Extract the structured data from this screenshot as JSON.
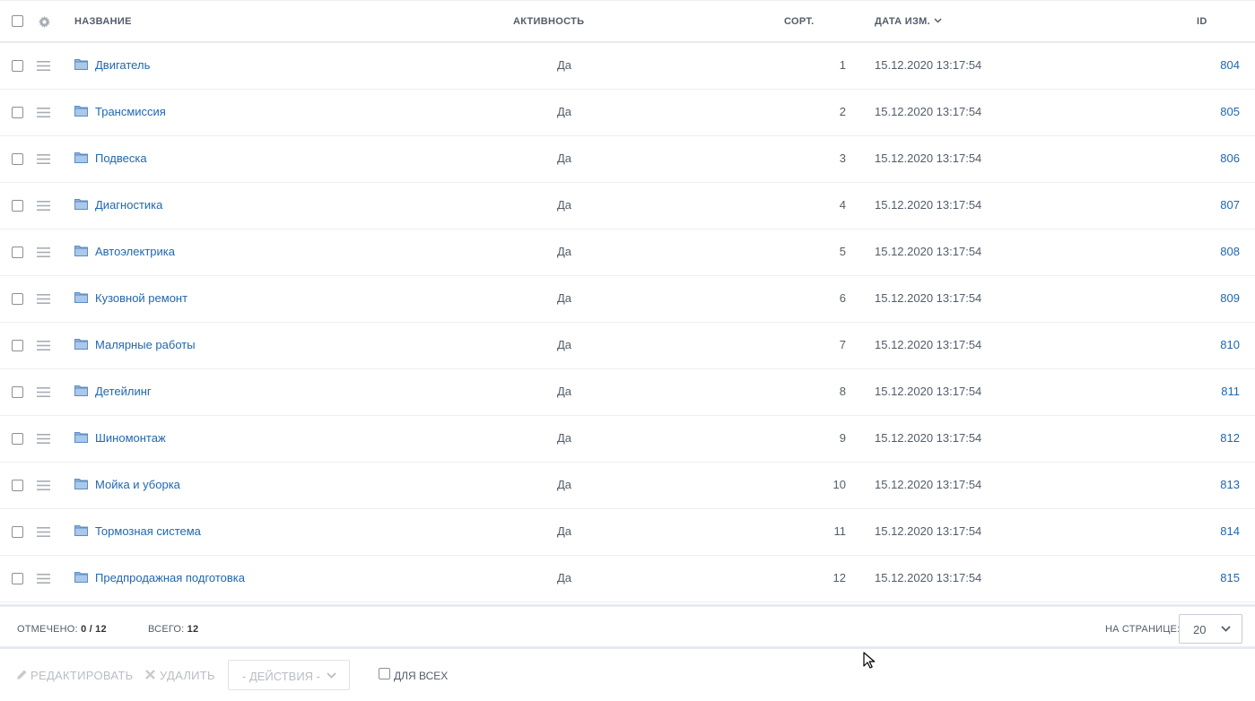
{
  "header": {
    "name": "Название",
    "active": "Активность",
    "sort": "Сорт.",
    "date": "Дата изм.",
    "id": "ID"
  },
  "rows": [
    {
      "name": "Двигатель",
      "active": "Да",
      "sort": "1",
      "date": "15.12.2020 13:17:54",
      "id": "804"
    },
    {
      "name": "Трансмиссия",
      "active": "Да",
      "sort": "2",
      "date": "15.12.2020 13:17:54",
      "id": "805"
    },
    {
      "name": "Подвеска",
      "active": "Да",
      "sort": "3",
      "date": "15.12.2020 13:17:54",
      "id": "806"
    },
    {
      "name": "Диагностика",
      "active": "Да",
      "sort": "4",
      "date": "15.12.2020 13:17:54",
      "id": "807"
    },
    {
      "name": "Автоэлектрика",
      "active": "Да",
      "sort": "5",
      "date": "15.12.2020 13:17:54",
      "id": "808"
    },
    {
      "name": "Кузовной ремонт",
      "active": "Да",
      "sort": "6",
      "date": "15.12.2020 13:17:54",
      "id": "809"
    },
    {
      "name": "Малярные работы",
      "active": "Да",
      "sort": "7",
      "date": "15.12.2020 13:17:54",
      "id": "810"
    },
    {
      "name": "Детейлинг",
      "active": "Да",
      "sort": "8",
      "date": "15.12.2020 13:17:54",
      "id": "811"
    },
    {
      "name": "Шиномонтаж",
      "active": "Да",
      "sort": "9",
      "date": "15.12.2020 13:17:54",
      "id": "812"
    },
    {
      "name": "Мойка и уборка",
      "active": "Да",
      "sort": "10",
      "date": "15.12.2020 13:17:54",
      "id": "813"
    },
    {
      "name": "Тормозная система",
      "active": "Да",
      "sort": "11",
      "date": "15.12.2020 13:17:54",
      "id": "814"
    },
    {
      "name": "Предпродажная подготовка",
      "active": "Да",
      "sort": "12",
      "date": "15.12.2020 13:17:54",
      "id": "815"
    }
  ],
  "footer": {
    "selected_label": "ОТМЕЧЕНО:",
    "selected_value": "0 / 12",
    "total_label": "ВСЕГО:",
    "total_value": "12",
    "per_page_label": "НА СТРАНИЦЕ:",
    "per_page_value": "20"
  },
  "actions": {
    "edit_label": "Редактировать",
    "delete_label": "Удалить",
    "actions_select": "- Действия -",
    "for_all_label": "Для всех"
  },
  "colors": {
    "link": "#2067b0",
    "text": "#535c69",
    "disabled": "#b9bdc3",
    "folder": "#8fb6df"
  },
  "icons": [
    "gear-icon",
    "drag-handle-icon",
    "folder-icon",
    "chevron-down-icon",
    "pencil-icon",
    "close-icon",
    "mouse-cursor-icon"
  ]
}
